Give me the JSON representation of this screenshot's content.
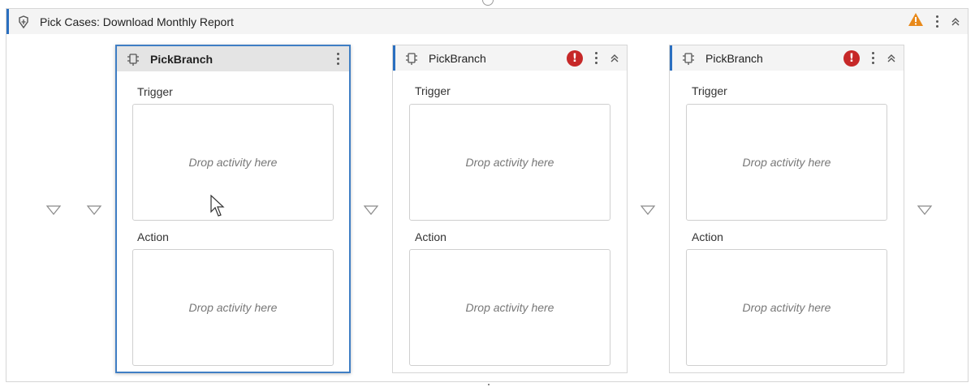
{
  "pick": {
    "title": "Pick Cases: Download Monthly Report",
    "header_icon": "pick-activity-icon",
    "warning_icon": "warning-triangle-icon",
    "colors": {
      "accent": "#2a6fc0",
      "warning": "#e8891a",
      "error": "#c62828"
    }
  },
  "branches": [
    {
      "title": "PickBranch",
      "selected": true,
      "has_error": false,
      "trigger_label": "Trigger",
      "trigger_placeholder": "Drop activity here",
      "action_label": "Action",
      "action_placeholder": "Drop activity here"
    },
    {
      "title": "PickBranch",
      "selected": false,
      "has_error": true,
      "error_glyph": "!",
      "trigger_label": "Trigger",
      "trigger_placeholder": "Drop activity here",
      "action_label": "Action",
      "action_placeholder": "Drop activity here"
    },
    {
      "title": "PickBranch",
      "selected": false,
      "has_error": true,
      "error_glyph": "!",
      "trigger_label": "Trigger",
      "trigger_placeholder": "Drop activity here",
      "action_label": "Action",
      "action_placeholder": "Drop activity here"
    }
  ]
}
